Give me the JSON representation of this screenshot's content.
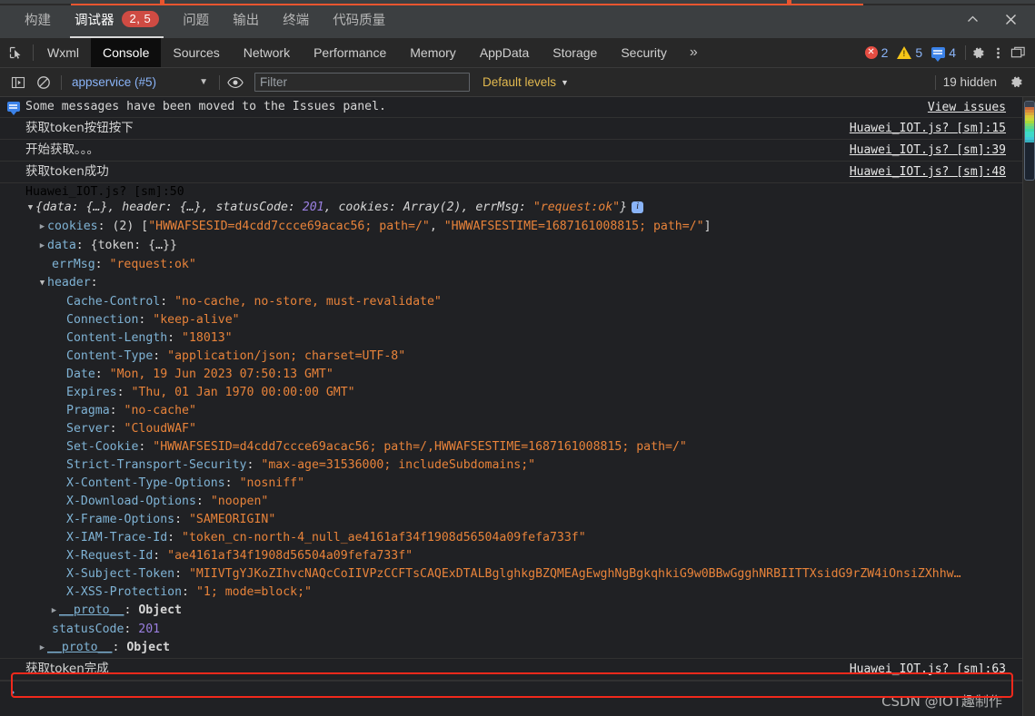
{
  "ide": {
    "tabs": [
      {
        "label": "构建",
        "active": false
      },
      {
        "label": "调试器",
        "active": true,
        "badge": "2, 5"
      },
      {
        "label": "问题",
        "active": false
      },
      {
        "label": "输出",
        "active": false
      },
      {
        "label": "终端",
        "active": false
      },
      {
        "label": "代码质量",
        "active": false
      }
    ],
    "collapse_icon": "chevron-up-icon",
    "close_icon": "close-icon"
  },
  "devtools": {
    "inspect_icon": "inspect-element-icon",
    "tabs": [
      {
        "label": "Wxml",
        "active": false
      },
      {
        "label": "Console",
        "active": true
      },
      {
        "label": "Sources",
        "active": false
      },
      {
        "label": "Network",
        "active": false
      },
      {
        "label": "Performance",
        "active": false
      },
      {
        "label": "Memory",
        "active": false
      },
      {
        "label": "AppData",
        "active": false
      },
      {
        "label": "Storage",
        "active": false
      },
      {
        "label": "Security",
        "active": false
      }
    ],
    "more_tabs_label": "»",
    "counters": {
      "errors": "2",
      "warnings": "5",
      "infos": "4"
    },
    "settings_icon": "gear-icon",
    "menu_icon": "kebab-menu-icon",
    "dock_icon": "dock-panel-icon"
  },
  "filterbar": {
    "sidebar_icon": "show-console-sidebar-icon",
    "clear_icon": "clear-console-icon",
    "context": "appservice (#5)",
    "context_caret": "chevron-down-icon",
    "eye_icon": "live-expression-eye-icon",
    "filter_value": "",
    "filter_placeholder": "Filter",
    "levels_label": "Default levels",
    "levels_caret": "chevron-down-icon",
    "hidden_label": "19 hidden",
    "settings_icon": "console-settings-gear-icon"
  },
  "console": {
    "issues_message": "Some messages have been moved to the Issues panel.",
    "issues_link": "View issues",
    "messages": [
      {
        "text": "获取token按钮按下",
        "source": "Huawei_IOT.js? [sm]:15"
      },
      {
        "text": "开始获取。。。",
        "source": "Huawei_IOT.js? [sm]:39"
      },
      {
        "text": "获取token成功",
        "source": "Huawei_IOT.js? [sm]:48"
      }
    ],
    "object_source": "Huawei_IOT.js? [sm]:50",
    "object": {
      "preview": "{data: {…}, header: {…}, statusCode: 201, cookies: Array(2), errMsg: \"request:ok\"}",
      "preview_parts": {
        "p1": "{data: {…}, header: {…}, statusCode: ",
        "status": "201",
        "p2": ", cookies: Array(2), errMsg: ",
        "errmsg": "\"request:ok\"",
        "p3": "}"
      },
      "cookies_key": "cookies",
      "cookies_count": "(2)",
      "cookies_val_a": "\"HWWAFSESID=d4cdd7ccce69acac56; path=/\"",
      "cookies_val_b": "\"HWWAFSESTIME=1687161008815; path=/\"",
      "data_key": "data",
      "data_val": "{token: {…}}",
      "errmsg_key": "errMsg",
      "errmsg_val": "\"request:ok\"",
      "header_key": "header",
      "headers": [
        {
          "name": "Cache-Control",
          "value": "\"no-cache, no-store, must-revalidate\""
        },
        {
          "name": "Connection",
          "value": "\"keep-alive\""
        },
        {
          "name": "Content-Length",
          "value": "\"18013\""
        },
        {
          "name": "Content-Type",
          "value": "\"application/json; charset=UTF-8\""
        },
        {
          "name": "Date",
          "value": "\"Mon, 19 Jun 2023 07:50:13 GMT\""
        },
        {
          "name": "Expires",
          "value": "\"Thu, 01 Jan 1970 00:00:00 GMT\""
        },
        {
          "name": "Pragma",
          "value": "\"no-cache\""
        },
        {
          "name": "Server",
          "value": "\"CloudWAF\""
        },
        {
          "name": "Set-Cookie",
          "value": "\"HWWAFSESID=d4cdd7ccce69acac56; path=/,HWWAFSESTIME=1687161008815; path=/\""
        },
        {
          "name": "Strict-Transport-Security",
          "value": "\"max-age=31536000; includeSubdomains;\""
        },
        {
          "name": "X-Content-Type-Options",
          "value": "\"nosniff\""
        },
        {
          "name": "X-Download-Options",
          "value": "\"noopen\""
        },
        {
          "name": "X-Frame-Options",
          "value": "\"SAMEORIGIN\""
        },
        {
          "name": "X-IAM-Trace-Id",
          "value": "\"token_cn-north-4_null_ae4161af34f1908d56504a09fefa733f\""
        },
        {
          "name": "X-Request-Id",
          "value": "\"ae4161af34f1908d56504a09fefa733f\""
        },
        {
          "name": "X-Subject-Token",
          "value": "\"MIIVTgYJKoZIhvcNAQcCoIIVPzCCFTsCAQExDTALBglghkgBZQMEAgEwghNgBgkqhkiG9w0BBwGgghNRBIITTXsidG9rZW4iOnsiZXhhw…",
          "highlighted": true
        },
        {
          "name": "X-XSS-Protection",
          "value": "\"1; mode=block;\""
        }
      ],
      "header_proto": "__proto__",
      "header_proto_val": "Object",
      "status_key": "statusCode",
      "status_val": "201",
      "root_proto": "__proto__",
      "root_proto_val": "Object"
    },
    "last_message": {
      "text": "获取token完成",
      "source": "Huawei_IOT.js? [sm]:63"
    },
    "prompt": "›"
  },
  "watermark": "CSDN @IOT趣制作",
  "colors": {
    "accent_red": "#cf4b43",
    "highlight_red": "#f2291c",
    "string_orange": "#e8833a",
    "prop_blue": "#7fb3d5",
    "number_purple": "#9a7fe0",
    "link_blue": "#8ab4f8"
  },
  "minimap_segments": [
    "#3a4250",
    "#3a4250",
    "#c96a3a",
    "#d98a3a",
    "#d9a93a",
    "#d9c93a",
    "#c9d93a",
    "#a9d93a",
    "#7fd96a",
    "#5fd98a",
    "#3fd9a9",
    "#3fd9c9",
    "#3fd9c9",
    "#3fc9d9",
    "#35b0c0"
  ]
}
